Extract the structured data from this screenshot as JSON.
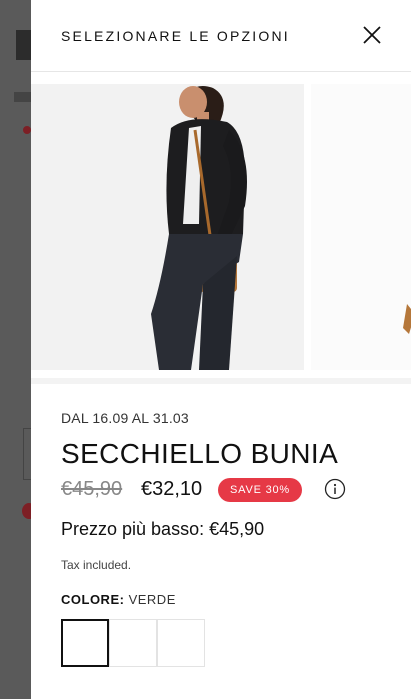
{
  "drawer": {
    "title": "SELEZIONARE LE OPZIONI",
    "close_icon": "close-icon"
  },
  "product": {
    "date_range": "DAL 16.09 AL 31.03",
    "name": "SECCHIELLO BUNIA",
    "old_price": "€45,90",
    "price": "€32,10",
    "save_badge": "SAVE 30%",
    "info_icon": "info-icon",
    "lowest_price": "Prezzo più basso: €45,90",
    "tax_note": "Tax included.",
    "color_label": "COLORE:",
    "color_value": "VERDE",
    "swatches": [
      {
        "selected": true
      },
      {
        "selected": false
      },
      {
        "selected": false
      }
    ]
  },
  "colors": {
    "badge": "#e63946",
    "text": "#111111",
    "muted": "#888888"
  }
}
